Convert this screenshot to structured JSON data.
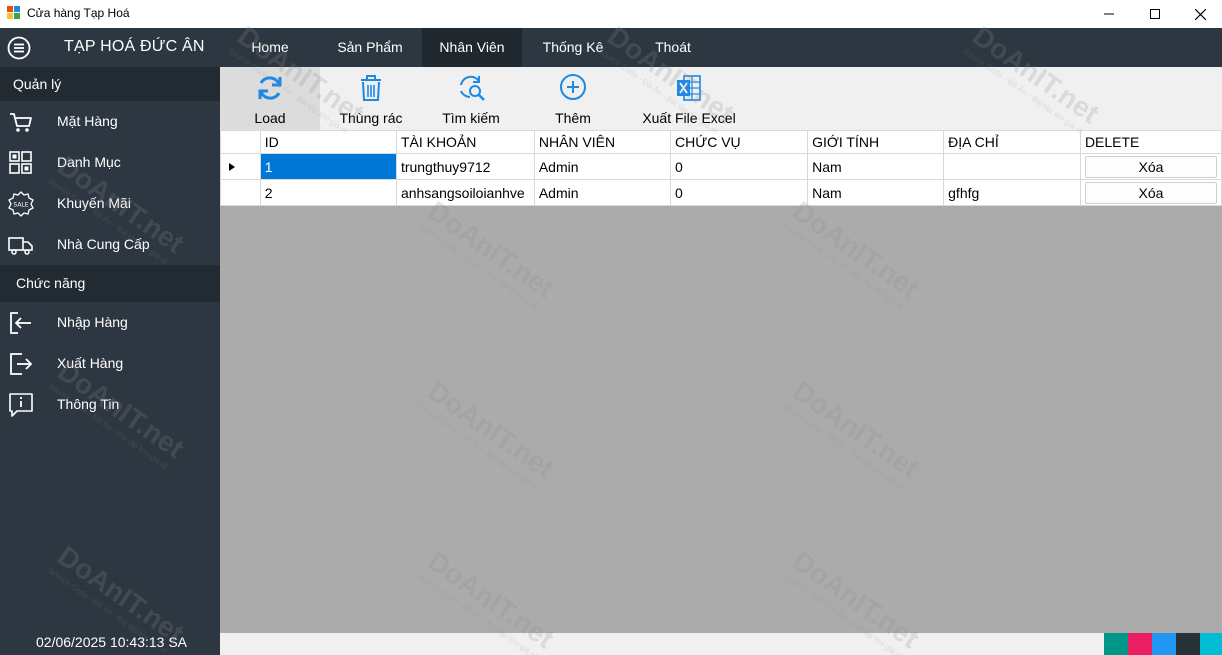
{
  "window": {
    "title": "Cửa hàng Tạp Hoá"
  },
  "topnav": {
    "brand": "TẠP HOÁ ĐỨC ÂN",
    "tabs": [
      "Home",
      "Sản Phẩm",
      "Nhân Viên",
      "Thống Kê",
      "Thoát"
    ],
    "active_tab": "Nhân Viên"
  },
  "sidebar": {
    "section_manage": "Quản lý",
    "manage_items": [
      {
        "label": "Mặt Hàng",
        "icon": "cart-icon"
      },
      {
        "label": "Danh Mục",
        "icon": "grid-icon"
      },
      {
        "label": "Khuyến Mãi",
        "icon": "sale-tag-icon"
      },
      {
        "label": "Nhà Cung Cấp",
        "icon": "truck-icon"
      }
    ],
    "section_functions": "Chức năng",
    "function_items": [
      {
        "label": "Nhập Hàng",
        "icon": "import-icon"
      },
      {
        "label": "Xuất Hàng",
        "icon": "export-icon"
      },
      {
        "label": "Thông Tin",
        "icon": "info-icon"
      }
    ],
    "datetime": "02/06/2025 10:43:13 SA"
  },
  "toolbar": {
    "load": "Load",
    "trash": "Thùng rác",
    "search": "Tìm kiếm",
    "add": "Thêm",
    "export_excel": "Xuất File Excel"
  },
  "grid": {
    "columns": [
      "ID",
      "TÀI KHOẢN",
      "NHÂN VIÊN",
      "CHỨC VỤ",
      "GIỚI TÍNH",
      "ĐỊA CHỈ",
      "DELETE"
    ],
    "rows": [
      {
        "id": "1",
        "account": "trungthuy9712",
        "employee": "Admin",
        "role": "0",
        "gender": "Nam",
        "address": "",
        "delete": "Xóa"
      },
      {
        "id": "2",
        "account": "anhsangsoiloianhve",
        "employee": "Admin",
        "role": "0",
        "gender": "Nam",
        "address": "gfhfg",
        "delete": "Xóa"
      }
    ]
  },
  "watermark": {
    "text": "DoAnIT.net",
    "subtext": "Source Code - Đồ Án - Bài tập lớn giá rẻ"
  },
  "colors": {
    "nav_bg": "#2d3741",
    "active_tab_bg": "#1f272f",
    "section_bg": "#222a32",
    "selection": "#0078d7",
    "swatches": [
      "#009688",
      "#e91e63",
      "#2196f3",
      "#263238",
      "#00bcd4"
    ]
  }
}
